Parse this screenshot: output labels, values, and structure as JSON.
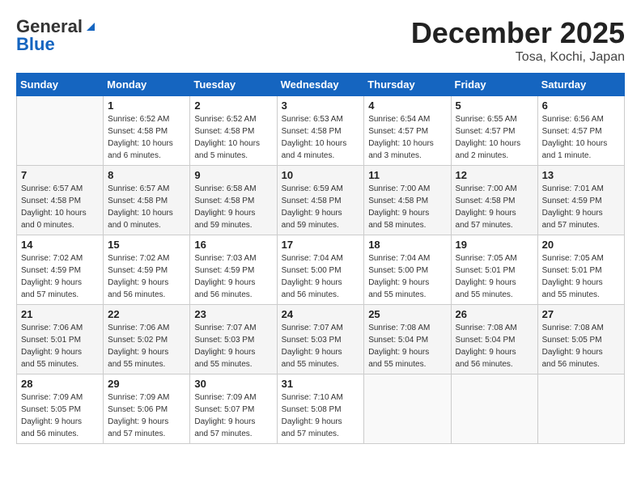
{
  "header": {
    "logo_general": "General",
    "logo_blue": "Blue",
    "month": "December 2025",
    "location": "Tosa, Kochi, Japan"
  },
  "weekdays": [
    "Sunday",
    "Monday",
    "Tuesday",
    "Wednesday",
    "Thursday",
    "Friday",
    "Saturday"
  ],
  "weeks": [
    [
      {
        "day": "",
        "info": ""
      },
      {
        "day": "1",
        "info": "Sunrise: 6:52 AM\nSunset: 4:58 PM\nDaylight: 10 hours\nand 6 minutes."
      },
      {
        "day": "2",
        "info": "Sunrise: 6:52 AM\nSunset: 4:58 PM\nDaylight: 10 hours\nand 5 minutes."
      },
      {
        "day": "3",
        "info": "Sunrise: 6:53 AM\nSunset: 4:58 PM\nDaylight: 10 hours\nand 4 minutes."
      },
      {
        "day": "4",
        "info": "Sunrise: 6:54 AM\nSunset: 4:57 PM\nDaylight: 10 hours\nand 3 minutes."
      },
      {
        "day": "5",
        "info": "Sunrise: 6:55 AM\nSunset: 4:57 PM\nDaylight: 10 hours\nand 2 minutes."
      },
      {
        "day": "6",
        "info": "Sunrise: 6:56 AM\nSunset: 4:57 PM\nDaylight: 10 hours\nand 1 minute."
      }
    ],
    [
      {
        "day": "7",
        "info": "Sunrise: 6:57 AM\nSunset: 4:58 PM\nDaylight: 10 hours\nand 0 minutes."
      },
      {
        "day": "8",
        "info": "Sunrise: 6:57 AM\nSunset: 4:58 PM\nDaylight: 10 hours\nand 0 minutes."
      },
      {
        "day": "9",
        "info": "Sunrise: 6:58 AM\nSunset: 4:58 PM\nDaylight: 9 hours\nand 59 minutes."
      },
      {
        "day": "10",
        "info": "Sunrise: 6:59 AM\nSunset: 4:58 PM\nDaylight: 9 hours\nand 59 minutes."
      },
      {
        "day": "11",
        "info": "Sunrise: 7:00 AM\nSunset: 4:58 PM\nDaylight: 9 hours\nand 58 minutes."
      },
      {
        "day": "12",
        "info": "Sunrise: 7:00 AM\nSunset: 4:58 PM\nDaylight: 9 hours\nand 57 minutes."
      },
      {
        "day": "13",
        "info": "Sunrise: 7:01 AM\nSunset: 4:59 PM\nDaylight: 9 hours\nand 57 minutes."
      }
    ],
    [
      {
        "day": "14",
        "info": "Sunrise: 7:02 AM\nSunset: 4:59 PM\nDaylight: 9 hours\nand 57 minutes."
      },
      {
        "day": "15",
        "info": "Sunrise: 7:02 AM\nSunset: 4:59 PM\nDaylight: 9 hours\nand 56 minutes."
      },
      {
        "day": "16",
        "info": "Sunrise: 7:03 AM\nSunset: 4:59 PM\nDaylight: 9 hours\nand 56 minutes."
      },
      {
        "day": "17",
        "info": "Sunrise: 7:04 AM\nSunset: 5:00 PM\nDaylight: 9 hours\nand 56 minutes."
      },
      {
        "day": "18",
        "info": "Sunrise: 7:04 AM\nSunset: 5:00 PM\nDaylight: 9 hours\nand 55 minutes."
      },
      {
        "day": "19",
        "info": "Sunrise: 7:05 AM\nSunset: 5:01 PM\nDaylight: 9 hours\nand 55 minutes."
      },
      {
        "day": "20",
        "info": "Sunrise: 7:05 AM\nSunset: 5:01 PM\nDaylight: 9 hours\nand 55 minutes."
      }
    ],
    [
      {
        "day": "21",
        "info": "Sunrise: 7:06 AM\nSunset: 5:01 PM\nDaylight: 9 hours\nand 55 minutes."
      },
      {
        "day": "22",
        "info": "Sunrise: 7:06 AM\nSunset: 5:02 PM\nDaylight: 9 hours\nand 55 minutes."
      },
      {
        "day": "23",
        "info": "Sunrise: 7:07 AM\nSunset: 5:03 PM\nDaylight: 9 hours\nand 55 minutes."
      },
      {
        "day": "24",
        "info": "Sunrise: 7:07 AM\nSunset: 5:03 PM\nDaylight: 9 hours\nand 55 minutes."
      },
      {
        "day": "25",
        "info": "Sunrise: 7:08 AM\nSunset: 5:04 PM\nDaylight: 9 hours\nand 55 minutes."
      },
      {
        "day": "26",
        "info": "Sunrise: 7:08 AM\nSunset: 5:04 PM\nDaylight: 9 hours\nand 56 minutes."
      },
      {
        "day": "27",
        "info": "Sunrise: 7:08 AM\nSunset: 5:05 PM\nDaylight: 9 hours\nand 56 minutes."
      }
    ],
    [
      {
        "day": "28",
        "info": "Sunrise: 7:09 AM\nSunset: 5:05 PM\nDaylight: 9 hours\nand 56 minutes."
      },
      {
        "day": "29",
        "info": "Sunrise: 7:09 AM\nSunset: 5:06 PM\nDaylight: 9 hours\nand 57 minutes."
      },
      {
        "day": "30",
        "info": "Sunrise: 7:09 AM\nSunset: 5:07 PM\nDaylight: 9 hours\nand 57 minutes."
      },
      {
        "day": "31",
        "info": "Sunrise: 7:10 AM\nSunset: 5:08 PM\nDaylight: 9 hours\nand 57 minutes."
      },
      {
        "day": "",
        "info": ""
      },
      {
        "day": "",
        "info": ""
      },
      {
        "day": "",
        "info": ""
      }
    ]
  ]
}
